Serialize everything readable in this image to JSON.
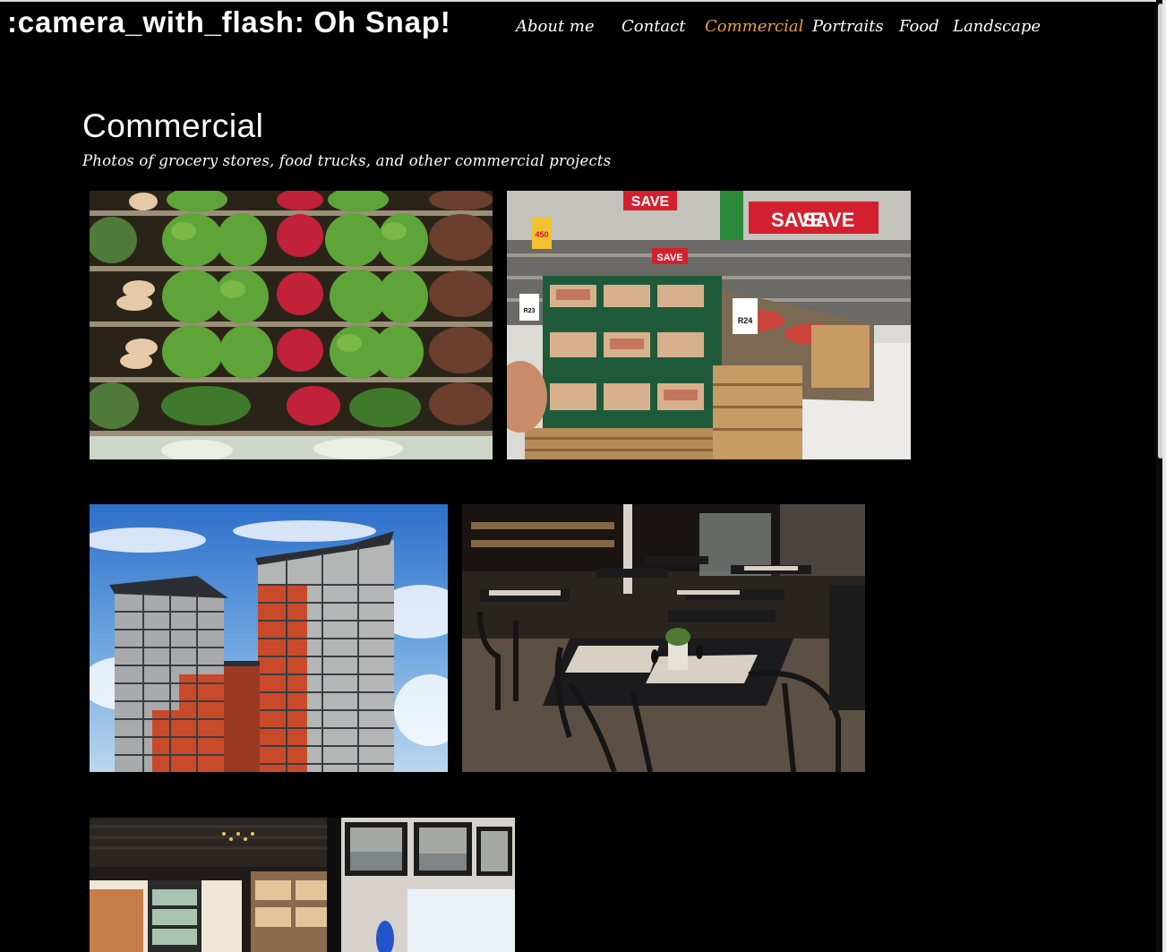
{
  "site": {
    "brand": ":camera_with_flash: Oh Snap!"
  },
  "nav": {
    "items": [
      {
        "label": "About me",
        "active": false
      },
      {
        "label": "Contact",
        "active": false
      },
      {
        "label": "Commercial",
        "active": true
      },
      {
        "label": "Portraits",
        "active": false
      },
      {
        "label": "Food",
        "active": false
      },
      {
        "label": "Landscape",
        "active": false
      }
    ],
    "active_color": "#e8a13c",
    "text_color": "#ffffff"
  },
  "page": {
    "title": "Commercial",
    "subtitle": "Photos of grocery stores, food trucks, and other commercial projects",
    "background": "#000000"
  },
  "gallery": {
    "photos": [
      {
        "subject": "produce-shelves"
      },
      {
        "subject": "supermarket-aisle",
        "signs": [
          "SAVE",
          "SAVE",
          "SAVE",
          "SAVE",
          "450",
          "R24",
          "R23"
        ]
      },
      {
        "subject": "apartment-towers"
      },
      {
        "subject": "restaurant-interior"
      },
      {
        "subject": "cafe-interior"
      }
    ]
  }
}
